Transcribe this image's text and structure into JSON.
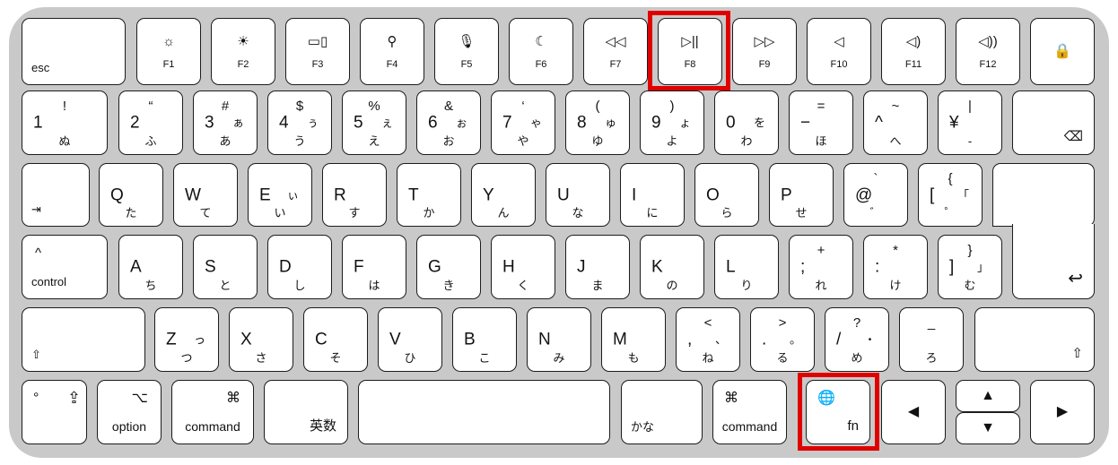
{
  "highlight_color": "#e00000",
  "highlighted_keys": [
    "F8",
    "fn"
  ],
  "rows": {
    "function": [
      {
        "name": "esc",
        "bl": "esc"
      },
      {
        "name": "f1",
        "icon": "☼",
        "label": "F1"
      },
      {
        "name": "f2",
        "icon": "☀",
        "label": "F2"
      },
      {
        "name": "f3",
        "icon": "▭▯",
        "label": "F3"
      },
      {
        "name": "f4",
        "icon": "⚲",
        "label": "F4"
      },
      {
        "name": "f5",
        "icon": "🎙",
        "label": "F5"
      },
      {
        "name": "f6",
        "icon": "☾",
        "label": "F6"
      },
      {
        "name": "f7",
        "icon": "◁◁",
        "label": "F7"
      },
      {
        "name": "f8",
        "icon": "▷||",
        "label": "F8"
      },
      {
        "name": "f9",
        "icon": "▷▷",
        "label": "F9"
      },
      {
        "name": "f10",
        "icon": "◁",
        "label": "F10"
      },
      {
        "name": "f11",
        "icon": "◁)",
        "label": "F11"
      },
      {
        "name": "f12",
        "icon": "◁))",
        "label": "F12"
      },
      {
        "name": "lock",
        "ctr": "🔒"
      }
    ],
    "number": [
      {
        "name": "1",
        "main": "1",
        "top": "!",
        "bottom": "ぬ"
      },
      {
        "name": "2",
        "main": "2",
        "top": "“",
        "bottom": "ふ"
      },
      {
        "name": "3",
        "main": "3",
        "top": "#",
        "right": "ぁ",
        "bottom": "あ"
      },
      {
        "name": "4",
        "main": "4",
        "top": "$",
        "right": "ぅ",
        "bottom": "う"
      },
      {
        "name": "5",
        "main": "5",
        "top": "%",
        "right": "ぇ",
        "bottom": "え"
      },
      {
        "name": "6",
        "main": "6",
        "top": "&",
        "right": "ぉ",
        "bottom": "お"
      },
      {
        "name": "7",
        "main": "7",
        "top": "‘",
        "right": "ゃ",
        "bottom": "や"
      },
      {
        "name": "8",
        "main": "8",
        "top": "(",
        "right": "ゅ",
        "bottom": "ゆ"
      },
      {
        "name": "9",
        "main": "9",
        "top": ")",
        "right": "ょ",
        "bottom": "よ"
      },
      {
        "name": "0",
        "main": "0",
        "right": "を",
        "bottom": "わ"
      },
      {
        "name": "minus",
        "main": "−",
        "top": "=",
        "bottom": "ほ"
      },
      {
        "name": "caret",
        "main": "^",
        "top": "~",
        "bottom": "へ"
      },
      {
        "name": "yen",
        "main": "¥",
        "top": "|",
        "bottom": "-"
      },
      {
        "name": "delete",
        "br": "⌫"
      }
    ],
    "qwerty": [
      {
        "name": "tab",
        "bl": "⇥"
      },
      {
        "name": "q",
        "main": "Q",
        "bottom": "た"
      },
      {
        "name": "w",
        "main": "W",
        "bottom": "て"
      },
      {
        "name": "e",
        "main": "E",
        "right": "ぃ",
        "bottom": "い"
      },
      {
        "name": "r",
        "main": "R",
        "bottom": "す"
      },
      {
        "name": "t",
        "main": "T",
        "bottom": "か"
      },
      {
        "name": "y",
        "main": "Y",
        "bottom": "ん"
      },
      {
        "name": "u",
        "main": "U",
        "bottom": "な"
      },
      {
        "name": "i",
        "main": "I",
        "bottom": "に"
      },
      {
        "name": "o",
        "main": "O",
        "bottom": "ら"
      },
      {
        "name": "p",
        "main": "P",
        "bottom": "せ"
      },
      {
        "name": "at",
        "main": "@",
        "top": "`",
        "bottom": "゛"
      },
      {
        "name": "bracket-left",
        "main": "[",
        "top": "{",
        "right": "「",
        "bottom": "゜"
      }
    ],
    "home": [
      {
        "name": "control",
        "tl2": "^",
        "bl": "control"
      },
      {
        "name": "a",
        "main": "A",
        "bottom": "ち"
      },
      {
        "name": "s",
        "main": "S",
        "bottom": "と"
      },
      {
        "name": "d",
        "main": "D",
        "bottom": "し"
      },
      {
        "name": "f",
        "main": "F",
        "bottom": "は"
      },
      {
        "name": "g",
        "main": "G",
        "bottom": "き"
      },
      {
        "name": "h",
        "main": "H",
        "bottom": "く"
      },
      {
        "name": "j",
        "main": "J",
        "bottom": "ま"
      },
      {
        "name": "k",
        "main": "K",
        "bottom": "の"
      },
      {
        "name": "l",
        "main": "L",
        "bottom": "り"
      },
      {
        "name": "semicolon",
        "main": ";",
        "top": "+",
        "bottom": "れ"
      },
      {
        "name": "colon",
        "main": ":",
        "top": "*",
        "bottom": "け"
      },
      {
        "name": "bracket-right",
        "main": "]",
        "top": "}",
        "right": "」",
        "bottom": "む"
      }
    ],
    "shift": [
      {
        "name": "shift-left",
        "bl": "⇧"
      },
      {
        "name": "z",
        "main": "Z",
        "right": "っ",
        "bottom": "つ"
      },
      {
        "name": "x",
        "main": "X",
        "bottom": "さ"
      },
      {
        "name": "c",
        "main": "C",
        "bottom": "そ"
      },
      {
        "name": "v",
        "main": "V",
        "bottom": "ひ"
      },
      {
        "name": "b",
        "main": "B",
        "bottom": "こ"
      },
      {
        "name": "n",
        "main": "N",
        "bottom": "み"
      },
      {
        "name": "m",
        "main": "M",
        "bottom": "も"
      },
      {
        "name": "comma",
        "main": ",",
        "top": "<",
        "right": "、",
        "bottom": "ね"
      },
      {
        "name": "period",
        "main": ".",
        "top": ">",
        "right": "。",
        "bottom": "る"
      },
      {
        "name": "slash",
        "main": "/",
        "top": "?",
        "right": "・",
        "bottom": "め"
      },
      {
        "name": "underscore",
        "top": "_",
        "bottom": "ろ"
      },
      {
        "name": "shift-right",
        "br": "⇧"
      }
    ],
    "bottom": [
      {
        "name": "caps-lock",
        "tl": "°",
        "tl3": "⇪"
      },
      {
        "name": "option",
        "tr": "⌥",
        "bc": "option"
      },
      {
        "name": "command-left",
        "tr": "⌘",
        "bc": "command"
      },
      {
        "name": "eisu",
        "br": "英数"
      },
      {
        "name": "space"
      },
      {
        "name": "kana",
        "bl": "かな"
      },
      {
        "name": "command-right",
        "tl": "⌘",
        "bc": "command"
      },
      {
        "name": "fn",
        "tl": "🌐",
        "br": "fn"
      },
      {
        "name": "arrow-left",
        "ctr": "◀"
      },
      {
        "name": "arrow-up",
        "ctr": "▲"
      },
      {
        "name": "arrow-down",
        "ctr": "▼"
      },
      {
        "name": "arrow-right",
        "ctr": "▶"
      }
    ]
  },
  "return_key": {
    "symbol": "↩"
  }
}
